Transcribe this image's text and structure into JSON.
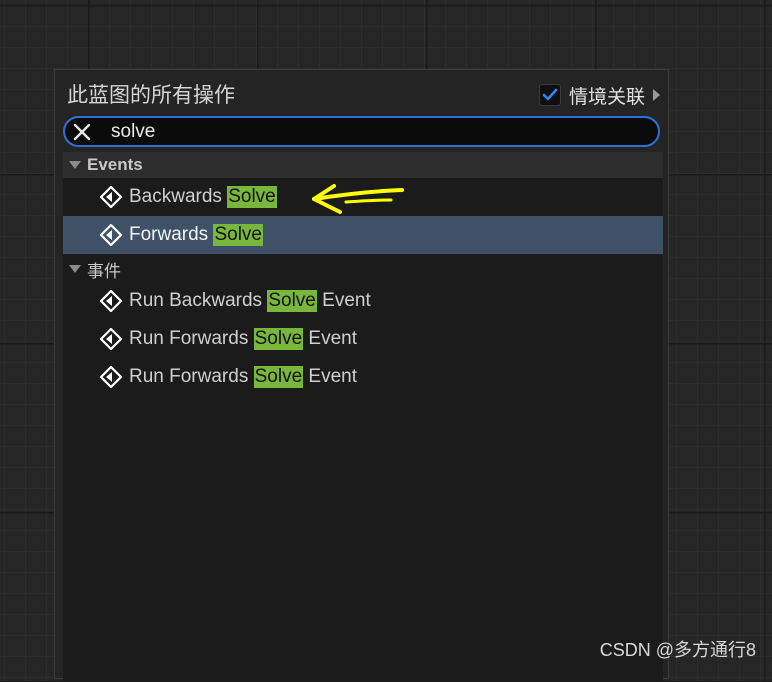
{
  "panel": {
    "title": "此蓝图的所有操作",
    "context_sensitive": {
      "label": "情境关联",
      "checked": true
    }
  },
  "search": {
    "value": "solve",
    "placeholder": ""
  },
  "categories": [
    {
      "label": "Events",
      "items": [
        {
          "prefix": "Backwards ",
          "match": "Solve",
          "suffix": "",
          "selected": false,
          "icon": "event-node-icon"
        },
        {
          "prefix": "Forwards ",
          "match": "Solve",
          "suffix": "",
          "selected": true,
          "icon": "event-node-icon"
        }
      ]
    },
    {
      "label": "事件",
      "items": [
        {
          "prefix": "Run Backwards ",
          "match": "Solve",
          "suffix": " Event",
          "selected": false,
          "icon": "event-node-icon"
        },
        {
          "prefix": "Run Forwards ",
          "match": "Solve",
          "suffix": " Event",
          "selected": false,
          "icon": "event-node-icon"
        },
        {
          "prefix": "Run Forwards ",
          "match": "Solve",
          "suffix": " Event",
          "selected": false,
          "icon": "event-node-icon"
        }
      ]
    }
  ],
  "annotation": {
    "icon": "yellow-arrow-annotation",
    "color": "#ffff00"
  },
  "watermark": "CSDN @多方通行8",
  "colors": {
    "accent": "#2c72d6",
    "highlight": "#78b63c",
    "selected_row": "#3f5166"
  }
}
